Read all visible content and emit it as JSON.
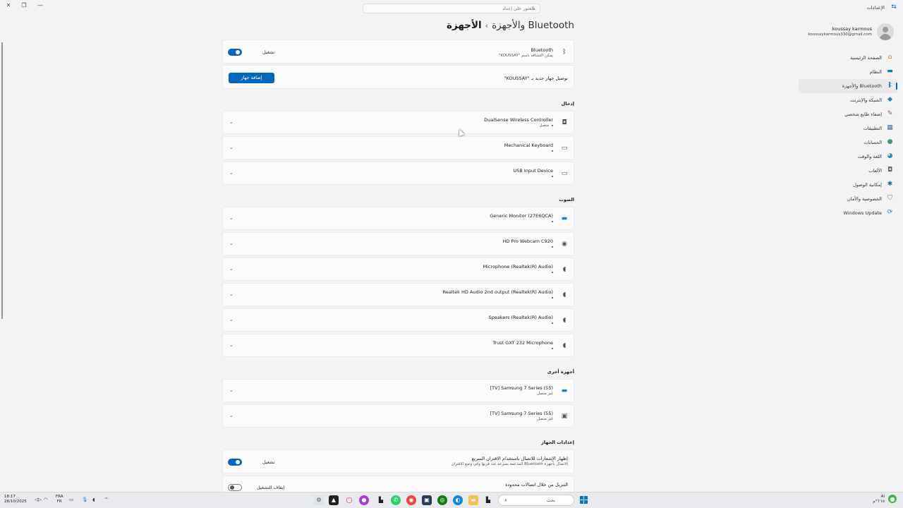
{
  "window": {
    "app_title": "الإعدادات",
    "search_placeholder": "العثور على إعداد",
    "controls": [
      "✕",
      "❐",
      "—"
    ]
  },
  "profile": {
    "name": "koussay karmous",
    "email": "koussaykarmous330@gmail.com"
  },
  "nav": [
    {
      "label": "الصفحة الرئيسية",
      "icon": "home-icon"
    },
    {
      "label": "النظام",
      "icon": "monitor-icon"
    },
    {
      "label": "Bluetooth والأجهزة",
      "icon": "bluetooth-icon",
      "active": true
    },
    {
      "label": "الشبكة والإنترنت",
      "icon": "wifi-icon"
    },
    {
      "label": "إضفاء طابع شخصي",
      "icon": "brush-icon"
    },
    {
      "label": "التطبيقات",
      "icon": "apps-icon"
    },
    {
      "label": "الحسابات",
      "icon": "person-icon"
    },
    {
      "label": "اللغة والوقت",
      "icon": "globe-icon"
    },
    {
      "label": "الألعاب",
      "icon": "gamepad-icon"
    },
    {
      "label": "إمكانية الوصول",
      "icon": "accessibility-icon"
    },
    {
      "label": "الخصوصية والأمان",
      "icon": "shield-icon"
    },
    {
      "label": "Windows Update",
      "icon": "update-icon"
    }
  ],
  "page": {
    "breadcrumb_parent": "Bluetooth والأجهزة",
    "breadcrumb_sep": "›",
    "breadcrumb_current": "الأجهزة"
  },
  "bluetooth": {
    "title": "Bluetooth",
    "subtitle": "يمكن اكتشافه باسم \"KOUSSAY\"",
    "toggle_label": "تشغيل"
  },
  "add_device": {
    "text": "توصيل جهاز جديد بـ \"KOUSSAY\"",
    "button": "إضافة جهاز"
  },
  "sections": {
    "input": "إدخال",
    "audio": "الصوت",
    "other": "أجهزة أخرى",
    "device_settings": "إعدادات الجهاز"
  },
  "input_devices": [
    {
      "name": "DualSense Wireless Controller",
      "status": "متصل",
      "icon": "gamepad-icon"
    },
    {
      "name": "Mechanical Keyboard",
      "status": "",
      "icon": "keyboard-icon"
    },
    {
      "name": "USB Input Device",
      "status": "",
      "icon": "keyboard-icon"
    }
  ],
  "audio_devices": [
    {
      "name": "Generic Monitor (27E6QCA)",
      "icon": "monitor-icon"
    },
    {
      "name": "HD Pro Webcam C920",
      "icon": "webcam-icon"
    },
    {
      "name": "Microphone (Realtek(R) Audio)",
      "icon": "speaker-icon"
    },
    {
      "name": "Realtek HD Audio 2nd output (Realtek(R) Audio)",
      "icon": "speaker-icon"
    },
    {
      "name": "Speakers (Realtek(R) Audio)",
      "icon": "speaker-icon"
    },
    {
      "name": "Trust GXT 232 Microphone",
      "icon": "speaker-icon"
    }
  ],
  "other_devices": [
    {
      "name": "[TV] Samsung 7 Series (55)",
      "status": "غير متصل",
      "icon": "monitor-icon"
    },
    {
      "name": "[TV] Samsung 7 Series (55)",
      "status": "غير متصل",
      "icon": "device-icon"
    }
  ],
  "device_settings": {
    "swift_pair_title": "إظهار الإشعارات للاتصال باستخدام الاقتران السريع",
    "swift_pair_sub": "الاتصال بأجهزة Bluetooth المدعمة بسرعة عند قربها وفي وضع الاقتران",
    "swift_pair_toggle": "تشغيل",
    "metered_title": "التنزيل من خلال اتصالات محدودة",
    "metered_toggle": "إيقاف التشغيل"
  },
  "taskbar": {
    "time": "18:17",
    "date": "28/10/2025",
    "lang_top": "FRA",
    "lang_bottom": "FR",
    "search_placeholder": "بحث",
    "right_top": "AI",
    "right_bottom": "٦٬١٥°م"
  }
}
